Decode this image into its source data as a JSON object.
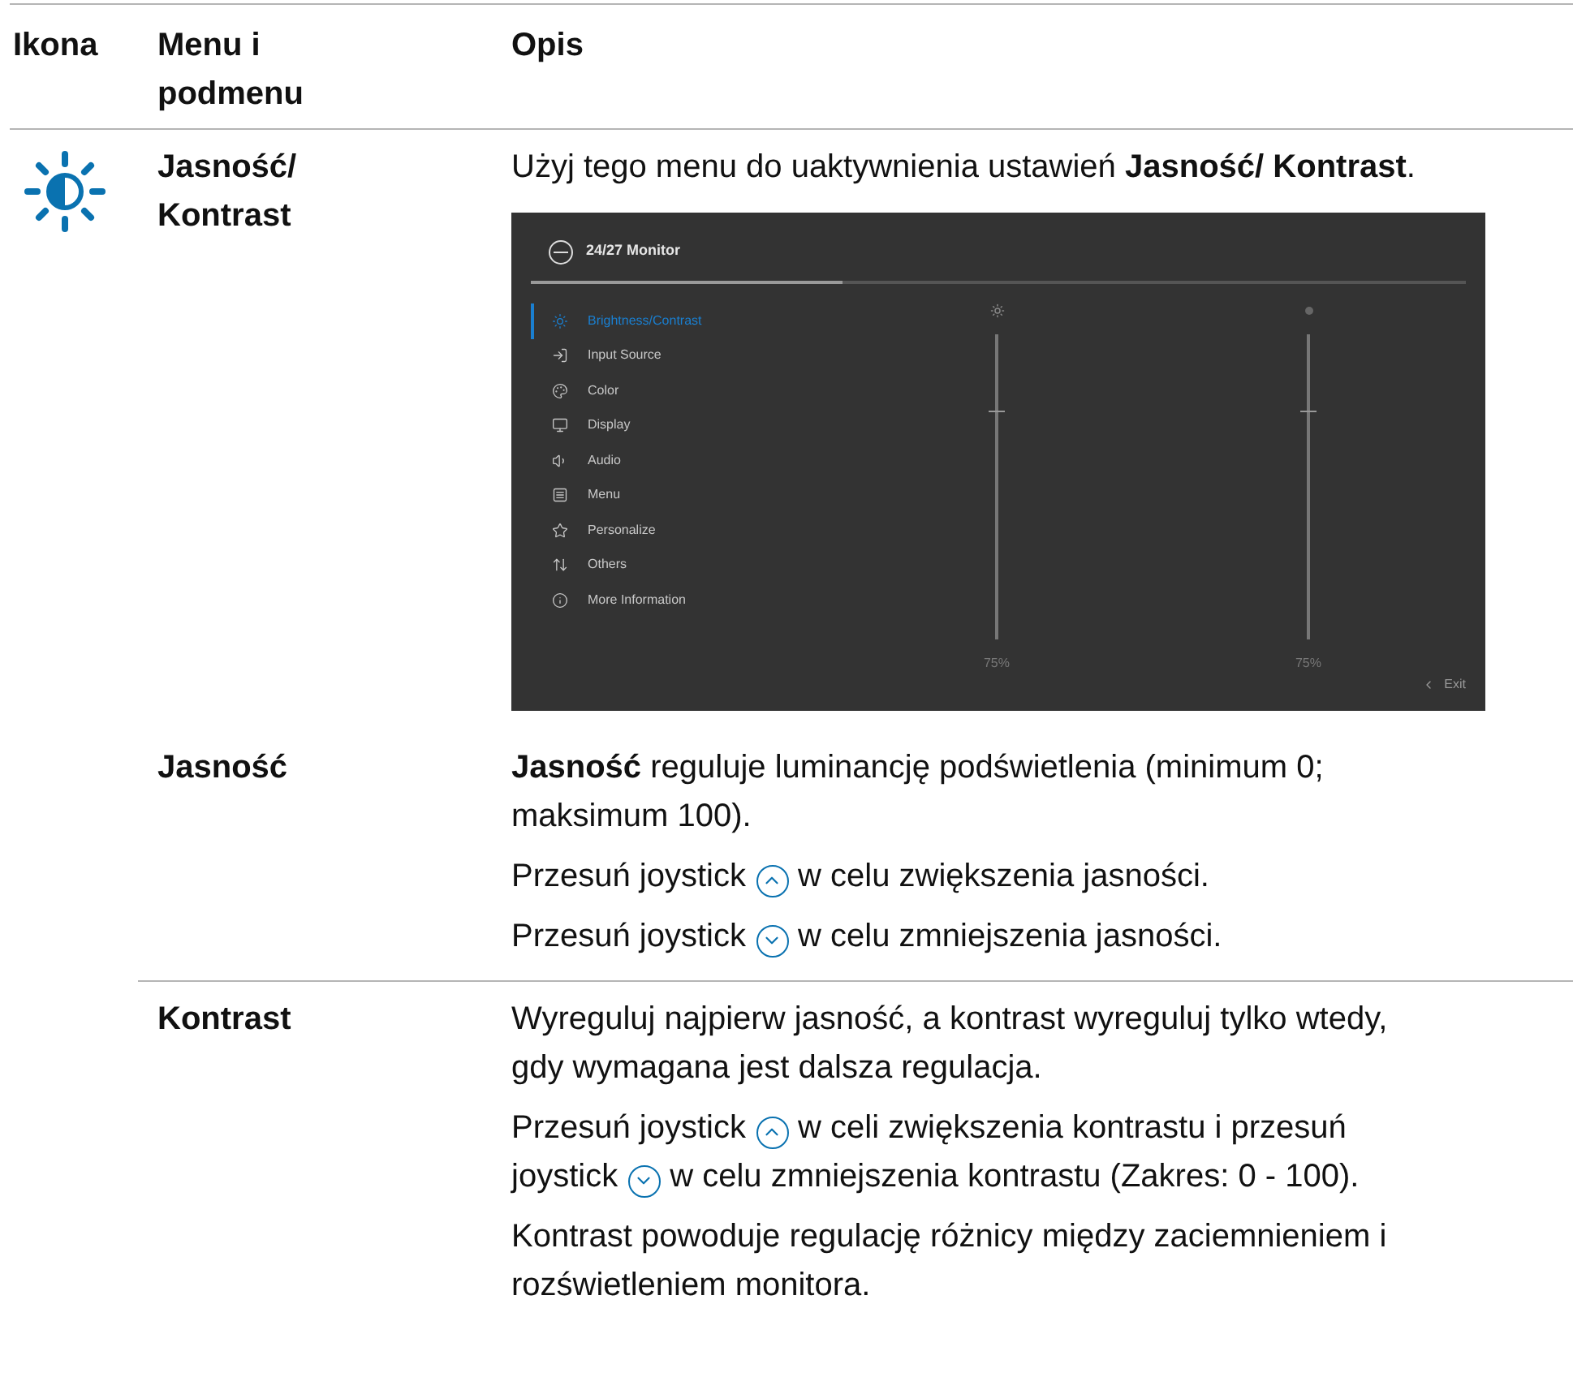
{
  "columns": [
    "Ikona",
    "Menu i podmenu",
    "Opis"
  ],
  "rows": [
    {
      "menu": "Jasność/ Kontrast",
      "paragraphs": [
        [
          {
            "kind": "text",
            "text": "Użyj tego menu do uaktywnienia ustawień **Jasność/**"
          },
          {
            "kind": "text",
            "text": "**Kontrast**."
          }
        ]
      ],
      "osd": {
        "title": "24/27 Monitor",
        "menu": [
          {
            "label": "Brightness/Contrast",
            "selected": true
          },
          {
            "label": "Input Source",
            "selected": false
          },
          {
            "label": "Color",
            "selected": false
          },
          {
            "label": "Display",
            "selected": false
          },
          {
            "label": "Audio",
            "selected": false
          },
          {
            "label": "Menu",
            "selected": false
          },
          {
            "label": "Personalize",
            "selected": false
          },
          {
            "label": "Others",
            "selected": false
          },
          {
            "label": "More Information",
            "selected": false
          }
        ],
        "sliders": [
          {
            "kind": "brightness",
            "level": 0.75,
            "reading": "75%"
          },
          {
            "kind": "contrast",
            "level": 0.75,
            "reading": "75%"
          }
        ],
        "exit": "Exit"
      }
    },
    {
      "menu": "Jasność",
      "paragraphs": [
        [
          {
            "kind": "text",
            "text": "**Jasność** reguluje luminancję podświetlenia (minimum 0; maksimum 100)."
          }
        ],
        [
          {
            "kind": "text",
            "text": "Przesuń joystick"
          },
          {
            "kind": "joystick_up"
          },
          {
            "kind": "text",
            "text": "w celu zwiększenia jasności."
          }
        ],
        [
          {
            "kind": "text",
            "text": "Przesuń joystick"
          },
          {
            "kind": "joystick_down"
          },
          {
            "kind": "text",
            "text": "w celu zmniejszenia jasności."
          }
        ]
      ]
    },
    {
      "menu": "Kontrast",
      "paragraphs": [
        [
          {
            "kind": "text",
            "text": "Wyreguluj najpierw jasność, a kontrast wyreguluj tylko wtedy, gdy wymagana jest dalsza regulacja."
          }
        ],
        [
          {
            "kind": "text",
            "text": "Przesuń joystick"
          },
          {
            "kind": "joystick_up"
          },
          {
            "kind": "text",
            "text": "w celi zwiększenia kontrastu i przesuń"
          },
          {
            "kind": "text",
            "text": "joystick"
          },
          {
            "kind": "joystick_down"
          },
          {
            "kind": "text",
            "text": "w celu zmniejszenia kontrastu (Zakres: 0 - 100)."
          }
        ],
        [
          {
            "kind": "text",
            "text": "Kontrast powoduje regulację różnicy między zaciemnieniem i rozświetleniem monitora."
          }
        ]
      ]
    }
  ]
}
